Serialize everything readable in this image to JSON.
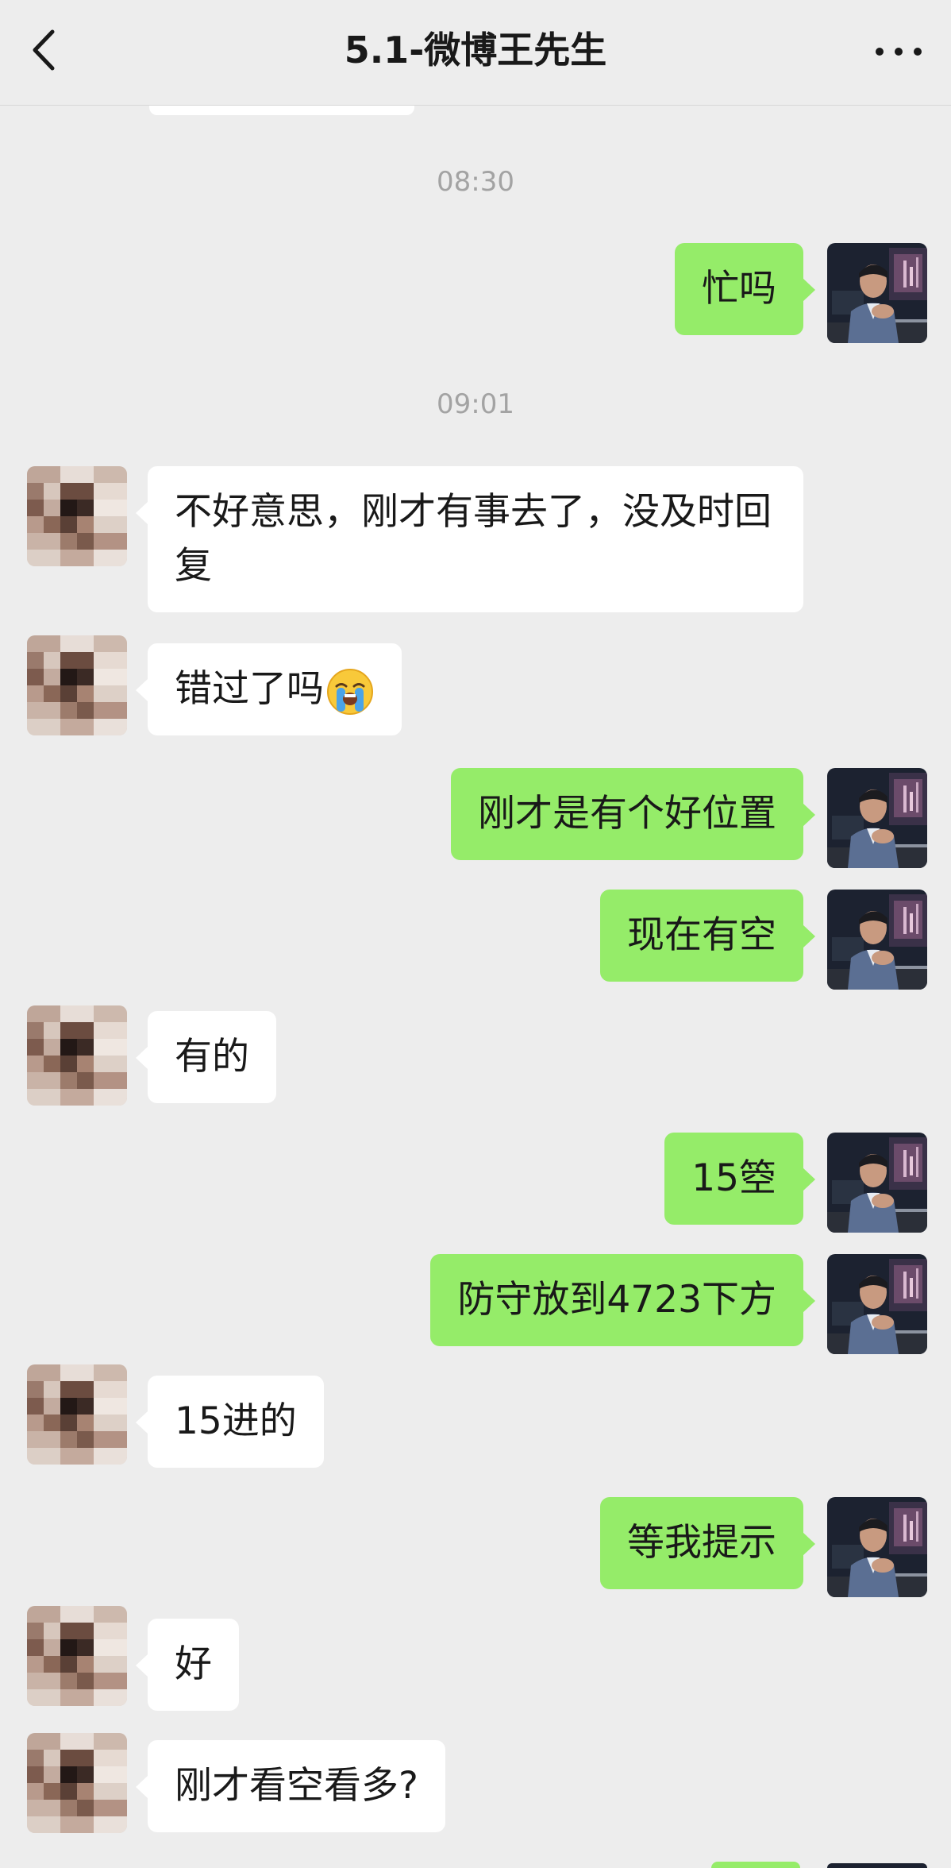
{
  "header": {
    "title": "5.1-微博王先生",
    "back_icon": "chevron-left-icon",
    "more_icon": "more-horizontal-icon"
  },
  "chat": {
    "times": [
      "08:30",
      "09:01"
    ],
    "messages": [
      {
        "side": "out",
        "text": "忙吗"
      },
      {
        "side": "in",
        "text": "不好意思，刚才有事去了，没及时回复"
      },
      {
        "side": "in",
        "text": "错过了吗",
        "emoji": "loudly-crying-face"
      },
      {
        "side": "out",
        "text": "刚才是有个好位置"
      },
      {
        "side": "out",
        "text": "现在有空"
      },
      {
        "side": "in",
        "text": "有的"
      },
      {
        "side": "out",
        "text": "15箜"
      },
      {
        "side": "out",
        "text": "防守放到4723下方"
      },
      {
        "side": "in",
        "text": "15进的"
      },
      {
        "side": "out",
        "text": "等我提示"
      },
      {
        "side": "in",
        "text": "好"
      },
      {
        "side": "in",
        "text": "刚才看空看多?"
      }
    ]
  },
  "colors": {
    "background": "#ededed",
    "bubble_out": "#95ec69",
    "bubble_in": "#ffffff",
    "time_text": "#a3a3a3"
  }
}
